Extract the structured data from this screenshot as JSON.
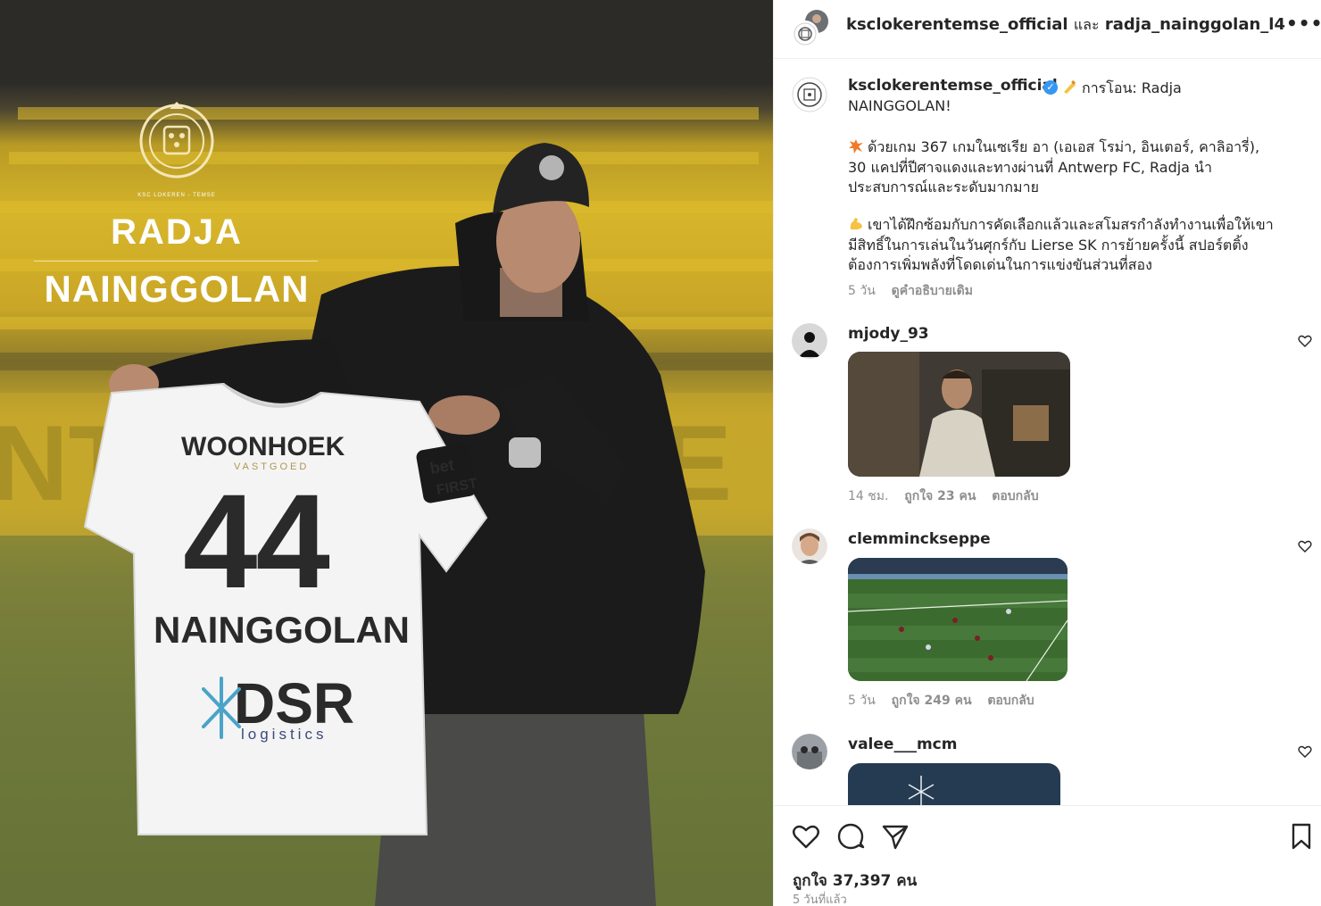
{
  "media": {
    "graphic_name_first": "RADJA",
    "graphic_name_last": "NAINGGOLAN",
    "club_crest_caption": "KSC LOKEREN - TEMSE",
    "shirt": {
      "sponsor_top": "WOONHOEK",
      "sponsor_top_sub": "VASTGOED",
      "number": "44",
      "name": "NAINGGOLAN",
      "sponsor_bottom": "DSR",
      "sponsor_bottom_sub": "logistics",
      "sleeve_badge_line1": "bet",
      "sleeve_badge_line2": "FIRST"
    },
    "colors": {
      "stadium_yellow": "#d6b52a",
      "pitch_green": "#6f7a3a"
    }
  },
  "header": {
    "user1": "ksclokerentemse_official",
    "conjunction": "และ",
    "user2": "radja_nainggolan_l4",
    "more_icon": "more-horizontal-icon"
  },
  "caption": {
    "username": "ksclokerentemse_official",
    "line1": "การโอน: Radja",
    "line2": "NAINGGOLAN!",
    "para2_line1": "ด้วยเกม 367 เกมในเซเรีย อา (เอเอส โรม่า, อินเตอร์, คาลิอารี่),",
    "para2_line2": "30 แคปที่ปีศาจแดงและทางผ่านที่ Antwerp FC, Radja นำ",
    "para2_line3": "ประสบการณ์และระดับมากมาย",
    "para3_line1": "เขาได้ฝึกซ้อมกับการคัดเลือกแล้วและสโมสรกำลังทำงานเพื่อให้เขา",
    "para3_line2": "มีสิทธิ์ในการเล่นในวันศุกร์กับ Lierse SK การย้ายครั้งนี้ สปอร์ตติ้ง",
    "para3_line3": "ต้องการเพิ่มพลังที่โดดเด่นในการแข่งขันส่วนที่สอง",
    "time": "5 วัน",
    "see_translation": "ดูคำอธิบายเดิม"
  },
  "comments": [
    {
      "username": "mjody_93",
      "time": "14 ชม.",
      "likes": "ถูกใจ 23 คน",
      "reply": "ตอบกลับ"
    },
    {
      "username": "clemminckseppe",
      "time": "5 วัน",
      "likes": "ถูกใจ 249 คน",
      "reply": "ตอบกลับ"
    },
    {
      "username": "valee___mcm"
    }
  ],
  "footer": {
    "likes": "ถูกใจ 37,397 คน",
    "time_ago": "5 วันที่แล้ว"
  }
}
